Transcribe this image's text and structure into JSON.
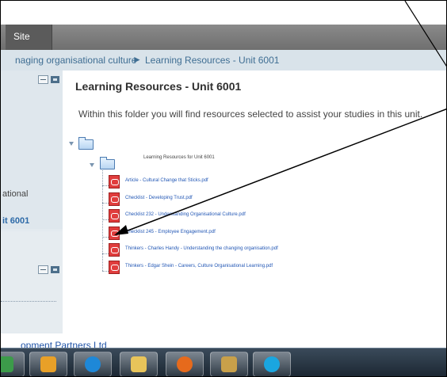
{
  "header": {
    "site_tab": "Site"
  },
  "breadcrumb": {
    "parent": "naging organisational culture",
    "separator": "►",
    "current": "Learning Resources - Unit 6001"
  },
  "sidebar": {
    "label_partial": "ational",
    "link_partial": "it 6001"
  },
  "main": {
    "title": "Learning Resources - Unit 6001",
    "description": "Within this folder you will find resources selected to assist your studies in this unit.",
    "subfolder": "Learning Resources for Unit 6001",
    "files": [
      "Article - Cultural Change that Sticks.pdf",
      "Checklist - Developing Trust.pdf",
      "Checklist 232 - Understanding Organisational Culture.pdf",
      "Checklist 245 - Employee Engagement.pdf",
      "Thinkers - Charles Handy - Understanding the changing organisation.pdf",
      "Thinkers - Edgar Shein - Careers, Culture Organisational Learning.pdf"
    ]
  },
  "footer": {
    "company_partial": "opment Partners Ltd"
  },
  "taskbar": {
    "icons": [
      "skype-like-icon",
      "outlook-icon",
      "internet-explorer-icon",
      "file-explorer-icon",
      "firefox-icon",
      "network-icon",
      "skype-icon"
    ]
  },
  "colors": {
    "link": "#2257b5",
    "breadcrumb": "#3f6e93",
    "pdf": "#e03d3d"
  }
}
